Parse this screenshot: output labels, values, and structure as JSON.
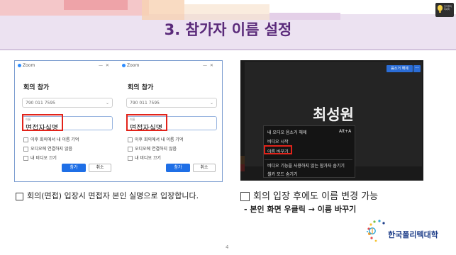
{
  "slide": {
    "title": "3. 참가자 이름 설정",
    "page_number": "4",
    "logo_top_text": "한국폴리텍대학"
  },
  "zoom_left": {
    "app_name": "Zoom",
    "heading": "회의 참가",
    "meeting_id": "790 011 7595",
    "name_label": "이름",
    "name_value": "면접자실명",
    "options": [
      "이후 회의에서 내 이름 기억",
      "오디오에 연결하지 않음",
      "내 비디오 끄기"
    ],
    "join_label": "참가",
    "cancel_label": "취소"
  },
  "zoom_right": {
    "app_name": "Zoom",
    "heading": "회의 참가",
    "meeting_id": "790 011 7595",
    "name_label": "이름",
    "name_value": "면접자실명",
    "options": [
      "이후 회의에서 내 이름 기억",
      "오디오에 연결하지 않음",
      "내 비디오 끄기"
    ],
    "join_label": "참가",
    "cancel_label": "취소"
  },
  "meeting_view": {
    "unmute_button": "음소거 해제",
    "more_button": "···",
    "participant_name": "최성원",
    "menu_items": [
      "내 오디오 음소거 해제",
      "비디오 시작",
      "이름 바꾸기",
      "비디오 기능을 사용하지 않는 참가자 숨기기",
      "셀카 모드 숨기기"
    ],
    "shortcut": "Alt+A"
  },
  "captions": {
    "left": "회의(면접) 입장시 면접자 본인 실명으로 입장합니다.",
    "right": "회의 입장 후에도 이름 변경 가능",
    "right_sub": "- 본인 화면 우클릭 → 이름 바꾸기"
  },
  "brand": {
    "name": "한국폴리텍대학"
  },
  "colors": {
    "title": "#5a2a7a",
    "highlight_red": "#e2231a",
    "zoom_blue": "#1f6fe6",
    "brand_blue": "#1f3f8a"
  }
}
